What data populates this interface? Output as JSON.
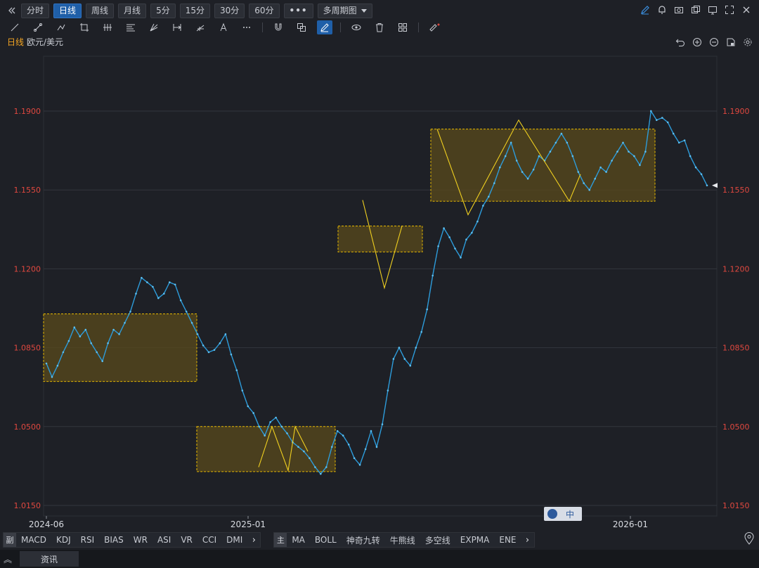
{
  "periods": {
    "collapse_icon": "double-chevron-left",
    "items": [
      "分时",
      "日线",
      "周线",
      "月线",
      "5分",
      "15分",
      "30分",
      "60分"
    ],
    "active_index": 1,
    "more": "•••",
    "multi": "多周期图"
  },
  "chart_header": {
    "period": "日线",
    "symbol": "欧元/美元"
  },
  "indicators": {
    "sub_head": "副",
    "sub": [
      "MACD",
      "KDJ",
      "RSI",
      "BIAS",
      "WR",
      "ASI",
      "VR",
      "CCI",
      "DMI"
    ],
    "main_head": "主",
    "main": [
      "MA",
      "BOLL",
      "神奇九转",
      "牛熊线",
      "多空线",
      "EXPMA",
      "ENE"
    ]
  },
  "bottom": {
    "news_tab": "资讯"
  },
  "watermark": "中",
  "colors": {
    "background": "#1e2026",
    "price_line": "#2d9cdb",
    "axis_label": "#e0483f",
    "box_fill": "#5a4a1c",
    "box_border": "#e6b800",
    "zigzag": "#f0d020",
    "active_button": "#1f5fa8"
  },
  "chart_data": {
    "type": "line",
    "title": "欧元/美元",
    "x_ticks": [
      "2024-06",
      "2025-01",
      "2026-01"
    ],
    "y_ticks": [
      "1.0150",
      "1.0500",
      "1.0850",
      "1.1200",
      "1.1550",
      "1.1900"
    ],
    "ylim": [
      1.015,
      1.19
    ],
    "series": [
      {
        "values": [
          1.078,
          1.072,
          1.077,
          1.083,
          1.088,
          1.094,
          1.09,
          1.093,
          1.087,
          1.083,
          1.079,
          1.087,
          1.093,
          1.091,
          1.096,
          1.101,
          1.109,
          1.116,
          1.114,
          1.112,
          1.107,
          1.109,
          1.114,
          1.113,
          1.106,
          1.101,
          1.096,
          1.091,
          1.086,
          1.083,
          1.084,
          1.087,
          1.091,
          1.082,
          1.075,
          1.066,
          1.059,
          1.056,
          1.05,
          1.046,
          1.052,
          1.054,
          1.05,
          1.047,
          1.043,
          1.041,
          1.039,
          1.036,
          1.032,
          1.029,
          1.032,
          1.041,
          1.048,
          1.046,
          1.042,
          1.036,
          1.033,
          1.04,
          1.048,
          1.041,
          1.051,
          1.066,
          1.08,
          1.085,
          1.08,
          1.077,
          1.085,
          1.092,
          1.102,
          1.117,
          1.13,
          1.138,
          1.134,
          1.129,
          1.125,
          1.133,
          1.136,
          1.141,
          1.148,
          1.152,
          1.158,
          1.165,
          1.17,
          1.176,
          1.168,
          1.163,
          1.16,
          1.164,
          1.17,
          1.168,
          1.172,
          1.176,
          1.18,
          1.176,
          1.17,
          1.163,
          1.158,
          1.155,
          1.16,
          1.165,
          1.163,
          1.168,
          1.172,
          1.176,
          1.172,
          1.17,
          1.166,
          1.172,
          1.19,
          1.186,
          1.187,
          1.185,
          1.18,
          1.176,
          1.177,
          1.17,
          1.165,
          1.162,
          1.157
        ]
      }
    ],
    "zones": [
      {
        "from": "2024-06",
        "to": "2024-09",
        "low": 1.07,
        "high": 1.1
      },
      {
        "from": "2024-11",
        "to": "2025-03",
        "low": 1.03,
        "high": 1.05
      },
      {
        "from": "2025-04",
        "to": "2025-06",
        "low": 1.1275,
        "high": 1.139
      },
      {
        "from": "2025-06",
        "to": "2026-01",
        "low": 1.15,
        "high": 1.182
      }
    ],
    "grid": true,
    "current_value_marker": true
  }
}
